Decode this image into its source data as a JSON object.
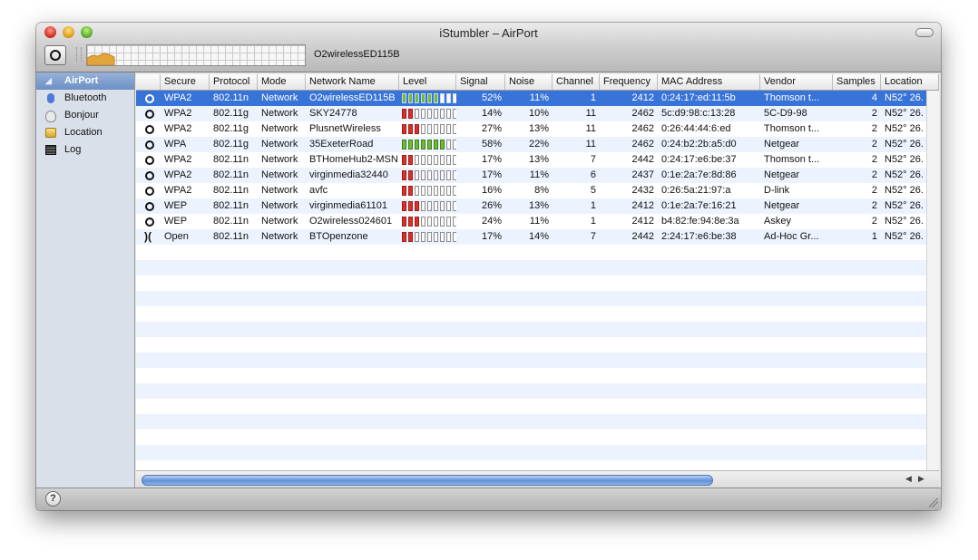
{
  "window": {
    "title": "iStumbler – AirPort"
  },
  "toolbar": {
    "current_network": "O2wirelessED115B"
  },
  "sidebar": {
    "items": [
      {
        "label": "AirPort",
        "icon": "airport-icon",
        "selected": true
      },
      {
        "label": "Bluetooth",
        "icon": "bluetooth-icon"
      },
      {
        "label": "Bonjour",
        "icon": "bonjour-icon"
      },
      {
        "label": "Location",
        "icon": "location-icon"
      },
      {
        "label": "Log",
        "icon": "log-icon"
      }
    ]
  },
  "table": {
    "columns": [
      "",
      "Secure",
      "Protocol",
      "Mode",
      "Network Name",
      "Level",
      "Signal",
      "Noise",
      "Channel",
      "Frequency",
      "MAC Address",
      "Vendor",
      "Samples",
      "Location"
    ],
    "rows": [
      {
        "status": "ring",
        "secure": "WPA2",
        "protocol": "802.11n",
        "mode": "Network",
        "name": "O2wirelessED115B",
        "level": 0.52,
        "level_color": "green",
        "signal": "52%",
        "noise": "11%",
        "channel": "1",
        "frequency": "2412",
        "mac": "0:24:17:ed:11:5b",
        "vendor": "Thomson t...",
        "samples": "4",
        "location": "N52° 26."
      },
      {
        "status": "ring",
        "secure": "WPA2",
        "protocol": "802.11g",
        "mode": "Network",
        "name": "SKY24778",
        "level": 0.14,
        "level_color": "red",
        "signal": "14%",
        "noise": "10%",
        "channel": "11",
        "frequency": "2462",
        "mac": "5c:d9:98:c:13:28",
        "vendor": "5C-D9-98",
        "samples": "2",
        "location": "N52° 26."
      },
      {
        "status": "ring",
        "secure": "WPA2",
        "protocol": "802.11g",
        "mode": "Network",
        "name": "PlusnetWireless",
        "level": 0.27,
        "level_color": "red",
        "signal": "27%",
        "noise": "13%",
        "channel": "11",
        "frequency": "2462",
        "mac": "0:26:44:44:6:ed",
        "vendor": "Thomson t...",
        "samples": "2",
        "location": "N52° 26."
      },
      {
        "status": "ring",
        "secure": "WPA",
        "protocol": "802.11g",
        "mode": "Network",
        "name": "35ExeterRoad",
        "level": 0.58,
        "level_color": "green",
        "signal": "58%",
        "noise": "22%",
        "channel": "11",
        "frequency": "2462",
        "mac": "0:24:b2:2b:a5:d0",
        "vendor": "Netgear",
        "samples": "2",
        "location": "N52° 26."
      },
      {
        "status": "ring",
        "secure": "WPA2",
        "protocol": "802.11n",
        "mode": "Network",
        "name": "BTHomeHub2-MSN",
        "level": 0.17,
        "level_color": "red",
        "signal": "17%",
        "noise": "13%",
        "channel": "7",
        "frequency": "2442",
        "mac": "0:24:17:e6:be:37",
        "vendor": "Thomson t...",
        "samples": "2",
        "location": "N52° 26."
      },
      {
        "status": "ring",
        "secure": "WPA2",
        "protocol": "802.11n",
        "mode": "Network",
        "name": "virginmedia32440",
        "level": 0.17,
        "level_color": "red",
        "signal": "17%",
        "noise": "11%",
        "channel": "6",
        "frequency": "2437",
        "mac": "0:1e:2a:7e:8d:86",
        "vendor": "Netgear",
        "samples": "2",
        "location": "N52° 26."
      },
      {
        "status": "ring",
        "secure": "WPA2",
        "protocol": "802.11n",
        "mode": "Network",
        "name": "avfc",
        "level": 0.16,
        "level_color": "red",
        "signal": "16%",
        "noise": "8%",
        "channel": "5",
        "frequency": "2432",
        "mac": "0:26:5a:21:97:a",
        "vendor": "D-link",
        "samples": "2",
        "location": "N52° 26."
      },
      {
        "status": "ring",
        "secure": "WEP",
        "protocol": "802.11n",
        "mode": "Network",
        "name": "virginmedia61101",
        "level": 0.26,
        "level_color": "red",
        "signal": "26%",
        "noise": "13%",
        "channel": "1",
        "frequency": "2412",
        "mac": "0:1e:2a:7e:16:21",
        "vendor": "Netgear",
        "samples": "2",
        "location": "N52° 26."
      },
      {
        "status": "ring",
        "secure": "WEP",
        "protocol": "802.11n",
        "mode": "Network",
        "name": "O2wireless024601",
        "level": 0.24,
        "level_color": "red",
        "signal": "24%",
        "noise": "11%",
        "channel": "1",
        "frequency": "2412",
        "mac": "b4:82:fe:94:8e:3a",
        "vendor": "Askey",
        "samples": "2",
        "location": "N52° 26."
      },
      {
        "status": "adhoc",
        "secure": "Open",
        "protocol": "802.11n",
        "mode": "Network",
        "name": "BTOpenzone",
        "level": 0.17,
        "level_color": "red",
        "signal": "17%",
        "noise": "14%",
        "channel": "7",
        "frequency": "2442",
        "mac": "2:24:17:e6:be:38",
        "vendor": "Ad-Hoc Gr...",
        "samples": "1",
        "location": "N52° 26."
      }
    ]
  },
  "footer": {
    "help_label": "?"
  },
  "colors": {
    "selection": "#3874d8",
    "stripe": "#edf3fe",
    "level_green": "#6dbb3a",
    "level_red": "#d9302a"
  }
}
